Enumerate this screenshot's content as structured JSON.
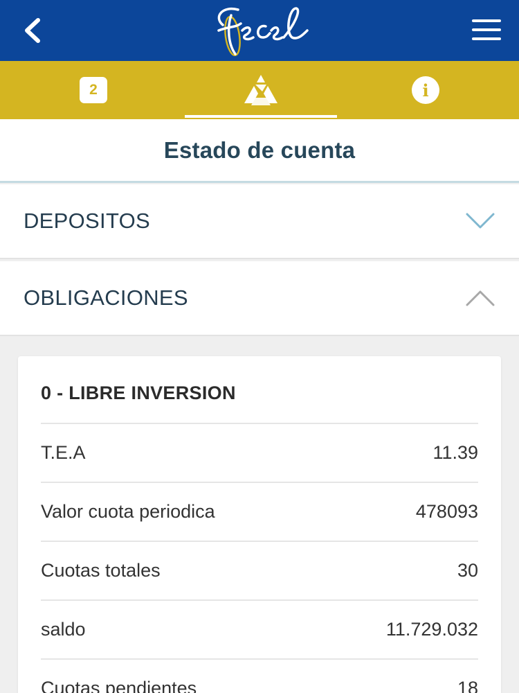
{
  "header": {
    "logo_text": "fecel",
    "back_icon": "chevron-left-icon",
    "menu_icon": "hamburger-menu-icon"
  },
  "tabs": [
    {
      "label": "2",
      "icon": "notification-badge-icon"
    },
    {
      "label": "",
      "icon": "triangle-logo-icon",
      "active": true
    },
    {
      "label": "i",
      "icon": "info-icon"
    }
  ],
  "page_title": "Estado de cuenta",
  "sections": {
    "deposits": {
      "label": "DEPOSITOS",
      "expanded": false
    },
    "obligations": {
      "label": "OBLIGACIONES",
      "expanded": true
    }
  },
  "card": {
    "title": "0 - LIBRE INVERSION",
    "rows": [
      {
        "label": "T.E.A",
        "value": "11.39"
      },
      {
        "label": "Valor cuota periodica",
        "value": "478093"
      },
      {
        "label": "Cuotas totales",
        "value": "30"
      },
      {
        "label": "saldo",
        "value": "11.729.032"
      },
      {
        "label": "Cuotas pendientes",
        "value": "18"
      }
    ]
  },
  "colors": {
    "header_blue": "#0c469a",
    "tab_gold": "#d4b521",
    "title_text": "#27475a",
    "chevron_blue": "#7fb7cf"
  }
}
